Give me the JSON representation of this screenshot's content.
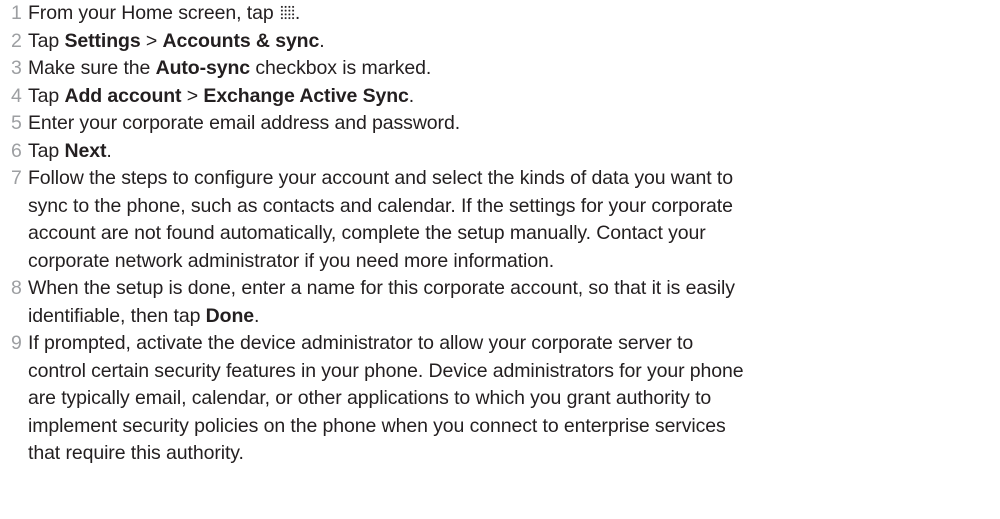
{
  "steps": [
    {
      "num": "1",
      "lines": [
        [
          "From your Home screen, tap ",
          {
            "icon": "app-grid-icon"
          },
          "."
        ]
      ]
    },
    {
      "num": "2",
      "lines": [
        [
          "Tap ",
          {
            "b": "Settings"
          },
          " > ",
          {
            "b": "Accounts & sync"
          },
          "."
        ]
      ]
    },
    {
      "num": "3",
      "lines": [
        [
          "Make sure the ",
          {
            "b": "Auto-sync"
          },
          " checkbox is marked."
        ]
      ]
    },
    {
      "num": "4",
      "lines": [
        [
          "Tap ",
          {
            "b": "Add account"
          },
          " > ",
          {
            "b": "Exchange Active Sync"
          },
          "."
        ]
      ]
    },
    {
      "num": "5",
      "lines": [
        [
          "Enter your corporate email address and password."
        ]
      ]
    },
    {
      "num": "6",
      "lines": [
        [
          "Tap ",
          {
            "b": "Next"
          },
          "."
        ]
      ]
    },
    {
      "num": "7",
      "lines": [
        [
          "Follow the steps to configure your account and select the kinds of data you want to"
        ],
        [
          "sync to the phone, such as contacts and calendar. If the settings for your corporate"
        ],
        [
          "account are not found automatically, complete the setup manually. Contact your"
        ],
        [
          "corporate network administrator if you need more information."
        ]
      ]
    },
    {
      "num": "8",
      "lines": [
        [
          "When the setup is done, enter a name for this corporate account, so that it is easily"
        ],
        [
          "identifiable, then tap ",
          {
            "b": "Done"
          },
          "."
        ]
      ]
    },
    {
      "num": "9",
      "lines": [
        [
          "If prompted, activate the device administrator to allow your corporate server to"
        ],
        [
          "control certain security features in your phone. Device administrators for your phone"
        ],
        [
          "are typically email, calendar, or other applications to which you grant authority to"
        ],
        [
          "implement security policies on the phone when you connect to enterprise services"
        ],
        [
          "that require this authority."
        ]
      ]
    }
  ]
}
